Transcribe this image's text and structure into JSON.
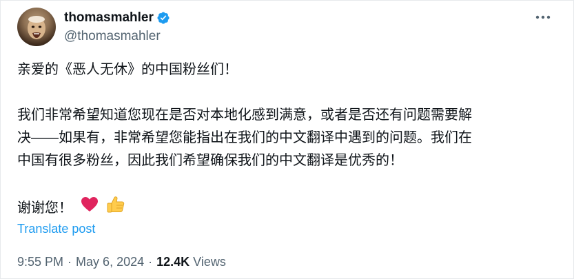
{
  "user": {
    "display_name": "thomasmahler",
    "handle": "@thomasmahler",
    "verified_icon": "verified-badge-icon",
    "verified_color": "#1d9bf0"
  },
  "more_icon": "more-horizontal-icon",
  "tweet": {
    "lines": [
      "亲爱的《恶人无休》的中国粉丝们！",
      "",
      "我们非常希望知道您现在是否对本地化感到满意，或者是否还有问题需要解",
      "决——如果有，非常希望您能指出在我们的中文翻译中遇到的问题。我们在",
      "中国有很多粉丝，因此我们希望确保我们的中文翻译是优秀的！",
      "",
      "谢谢您！"
    ],
    "emojis": [
      "red-heart-icon",
      "thumbs-up-icon"
    ]
  },
  "translate_label": "Translate post",
  "meta": {
    "time": "9:55 PM",
    "separator": "·",
    "date": "May 6, 2024",
    "views_count": "12.4K",
    "views_label": "Views"
  },
  "colors": {
    "text": "#0f1419",
    "secondary": "#536471",
    "link": "#1d9bf0",
    "heart": "#e0245e",
    "thumb": "#ffcc4d"
  }
}
